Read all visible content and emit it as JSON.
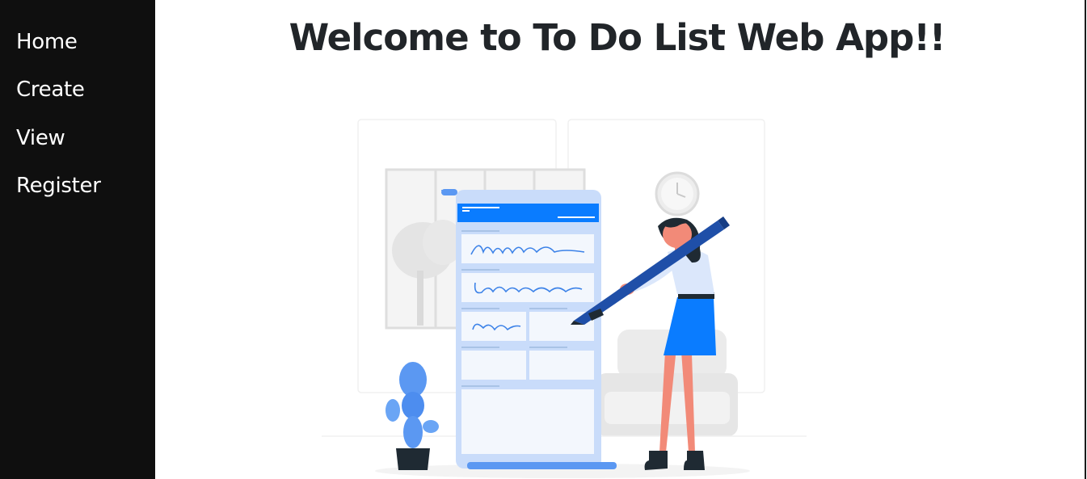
{
  "sidebar": {
    "items": [
      {
        "label": "Home"
      },
      {
        "label": "Create"
      },
      {
        "label": "View"
      },
      {
        "label": "Register"
      }
    ]
  },
  "main": {
    "title": "Welcome to To Do List Web App!!",
    "illustration": {
      "icon": "todo-list-writing-illustration",
      "colors": {
        "primary": "#0a7cff",
        "paper": "#c8dcfb",
        "paper_inner": "#f3f7fd",
        "dark": "#1f2a33",
        "skin": "#f28a78",
        "gray": "#ececec"
      }
    }
  }
}
